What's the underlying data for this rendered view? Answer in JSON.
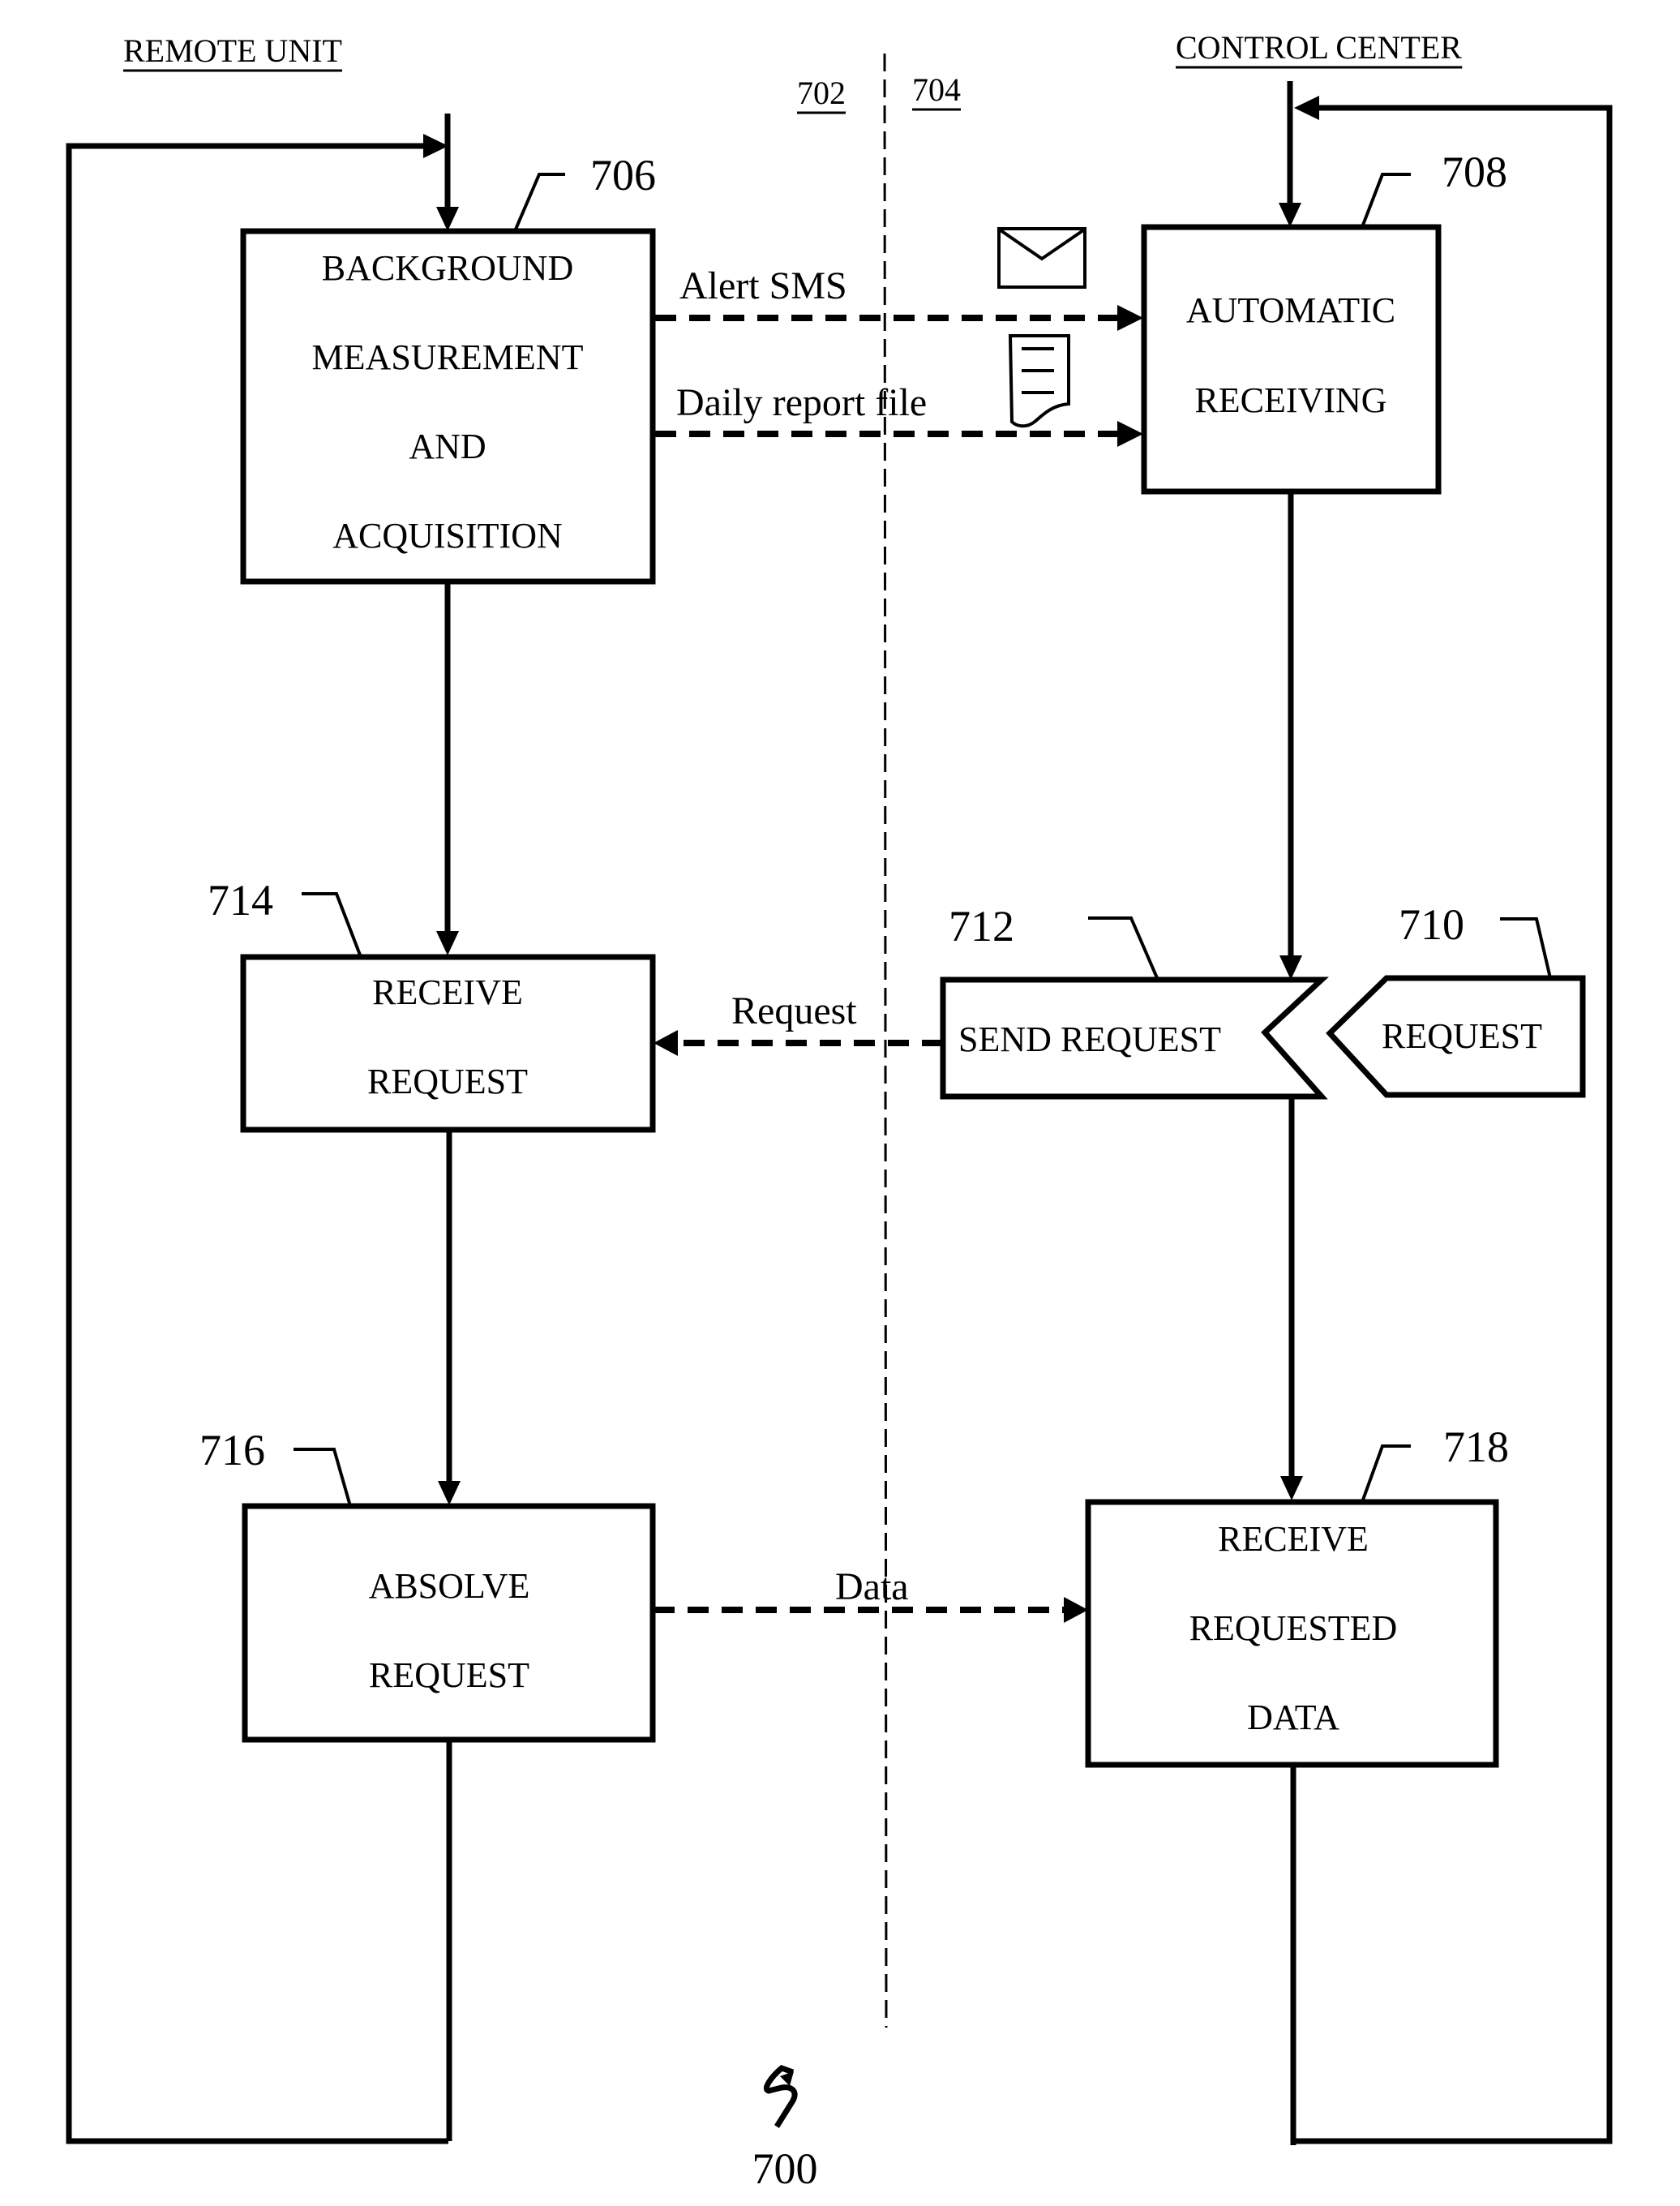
{
  "figure_number": "700",
  "lanes": {
    "left": {
      "title": "REMOTE UNIT",
      "ref": "702"
    },
    "right": {
      "title": "CONTROL CENTER",
      "ref": "704"
    }
  },
  "nodes": {
    "n706": {
      "ref": "706",
      "lines": [
        "BACKGROUND",
        "MEASUREMENT",
        "AND",
        "ACQUISITION"
      ]
    },
    "n708": {
      "ref": "708",
      "lines": [
        "AUTOMATIC",
        "RECEIVING"
      ]
    },
    "n710": {
      "ref": "710",
      "lines": [
        "REQUEST"
      ]
    },
    "n712": {
      "ref": "712",
      "lines": [
        "SEND REQUEST"
      ]
    },
    "n714": {
      "ref": "714",
      "lines": [
        "RECEIVE",
        "REQUEST"
      ]
    },
    "n716": {
      "ref": "716",
      "lines": [
        "ABSOLVE",
        "REQUEST"
      ]
    },
    "n718": {
      "ref": "718",
      "lines": [
        "RECEIVE",
        "REQUESTED",
        "DATA"
      ]
    }
  },
  "messages": {
    "alert": {
      "label": "Alert SMS",
      "icon": "envelope-icon"
    },
    "report": {
      "label": "Daily report file",
      "icon": "document-icon"
    },
    "request": {
      "label": "Request"
    },
    "data": {
      "label": "Data"
    }
  }
}
